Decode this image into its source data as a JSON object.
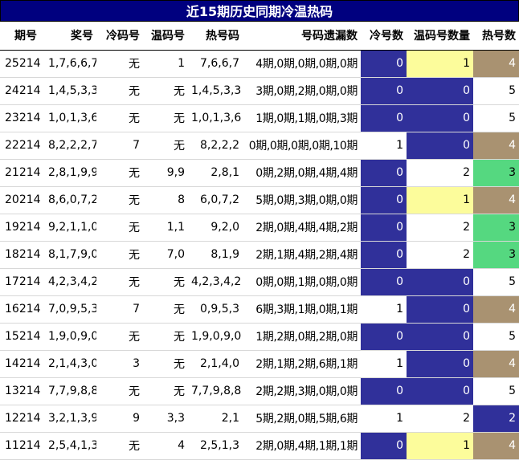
{
  "title": "近15期历史同期冷温热码",
  "headers": [
    "期号",
    "奖号",
    "冷码号",
    "温码号",
    "热号码",
    "号码遗漏数",
    "冷号数",
    "温码号数量",
    "热号数"
  ],
  "colors": {
    "title_bg": "#00007f",
    "navy": "#30309a",
    "yellow": "#fcfc9b",
    "tan": "#a99271",
    "green": "#55d880",
    "white": "#ffffff"
  },
  "rows": [
    {
      "issue": "25214",
      "draw": "1,7,6,6,7",
      "cold": "无",
      "warm": "1",
      "hot": "7,6,6,7",
      "miss": "4期,0期,0期,0期,0期",
      "cold_count": "0",
      "warm_count": "1",
      "hot_count": "4",
      "cold_style": "navy",
      "warm_style": "yellow",
      "hot_style": "tan"
    },
    {
      "issue": "24214",
      "draw": "1,4,5,3,3",
      "cold": "无",
      "warm": "无",
      "hot": "1,4,5,3,3",
      "miss": "3期,0期,2期,0期,0期",
      "cold_count": "0",
      "warm_count": "0",
      "hot_count": "5",
      "cold_style": "navy",
      "warm_style": "navy",
      "hot_style": "plain"
    },
    {
      "issue": "23214",
      "draw": "1,0,1,3,6",
      "cold": "无",
      "warm": "无",
      "hot": "1,0,1,3,6",
      "miss": "1期,0期,1期,0期,3期",
      "cold_count": "0",
      "warm_count": "0",
      "hot_count": "5",
      "cold_style": "navy",
      "warm_style": "navy",
      "hot_style": "plain"
    },
    {
      "issue": "22214",
      "draw": "8,2,2,2,7",
      "cold": "7",
      "warm": "无",
      "hot": "8,2,2,2",
      "miss": "0期,0期,0期,0期,10期",
      "cold_count": "1",
      "warm_count": "0",
      "hot_count": "4",
      "cold_style": "plain",
      "warm_style": "navy",
      "hot_style": "tan"
    },
    {
      "issue": "21214",
      "draw": "2,8,1,9,9",
      "cold": "无",
      "warm": "9,9",
      "hot": "2,8,1",
      "miss": "0期,2期,0期,4期,4期",
      "cold_count": "0",
      "warm_count": "2",
      "hot_count": "3",
      "cold_style": "navy",
      "warm_style": "plain",
      "hot_style": "green"
    },
    {
      "issue": "20214",
      "draw": "8,6,0,7,2",
      "cold": "无",
      "warm": "8",
      "hot": "6,0,7,2",
      "miss": "5期,0期,3期,0期,0期",
      "cold_count": "0",
      "warm_count": "1",
      "hot_count": "4",
      "cold_style": "navy",
      "warm_style": "yellow",
      "hot_style": "tan"
    },
    {
      "issue": "19214",
      "draw": "9,2,1,1,0",
      "cold": "无",
      "warm": "1,1",
      "hot": "9,2,0",
      "miss": "2期,0期,4期,4期,2期",
      "cold_count": "0",
      "warm_count": "2",
      "hot_count": "3",
      "cold_style": "navy",
      "warm_style": "plain",
      "hot_style": "green"
    },
    {
      "issue": "18214",
      "draw": "8,1,7,9,0",
      "cold": "无",
      "warm": "7,0",
      "hot": "8,1,9",
      "miss": "2期,1期,4期,2期,4期",
      "cold_count": "0",
      "warm_count": "2",
      "hot_count": "3",
      "cold_style": "navy",
      "warm_style": "plain",
      "hot_style": "green"
    },
    {
      "issue": "17214",
      "draw": "4,2,3,4,2",
      "cold": "无",
      "warm": "无",
      "hot": "4,2,3,4,2",
      "miss": "0期,0期,1期,0期,0期",
      "cold_count": "0",
      "warm_count": "0",
      "hot_count": "5",
      "cold_style": "navy",
      "warm_style": "navy",
      "hot_style": "plain"
    },
    {
      "issue": "16214",
      "draw": "7,0,9,5,3",
      "cold": "7",
      "warm": "无",
      "hot": "0,9,5,3",
      "miss": "6期,3期,1期,0期,1期",
      "cold_count": "1",
      "warm_count": "0",
      "hot_count": "4",
      "cold_style": "plain",
      "warm_style": "navy",
      "hot_style": "tan"
    },
    {
      "issue": "15214",
      "draw": "1,9,0,9,0",
      "cold": "无",
      "warm": "无",
      "hot": "1,9,0,9,0",
      "miss": "1期,2期,0期,2期,0期",
      "cold_count": "0",
      "warm_count": "0",
      "hot_count": "5",
      "cold_style": "navy",
      "warm_style": "navy",
      "hot_style": "plain"
    },
    {
      "issue": "14214",
      "draw": "2,1,4,3,0",
      "cold": "3",
      "warm": "无",
      "hot": "2,1,4,0",
      "miss": "2期,1期,2期,6期,1期",
      "cold_count": "1",
      "warm_count": "0",
      "hot_count": "4",
      "cold_style": "plain",
      "warm_style": "navy",
      "hot_style": "tan"
    },
    {
      "issue": "13214",
      "draw": "7,7,9,8,8",
      "cold": "无",
      "warm": "无",
      "hot": "7,7,9,8,8",
      "miss": "2期,2期,3期,0期,0期",
      "cold_count": "0",
      "warm_count": "0",
      "hot_count": "5",
      "cold_style": "navy",
      "warm_style": "navy",
      "hot_style": "plain"
    },
    {
      "issue": "12214",
      "draw": "3,2,1,3,9",
      "cold": "9",
      "warm": "3,3",
      "hot": "2,1",
      "miss": "5期,2期,0期,5期,6期",
      "cold_count": "1",
      "warm_count": "2",
      "hot_count": "2",
      "cold_style": "plain",
      "warm_style": "plain",
      "hot_style": "navy"
    },
    {
      "issue": "11214",
      "draw": "2,5,4,1,3",
      "cold": "无",
      "warm": "4",
      "hot": "2,5,1,3",
      "miss": "2期,0期,4期,1期,1期",
      "cold_count": "0",
      "warm_count": "1",
      "hot_count": "4",
      "cold_style": "navy",
      "warm_style": "yellow",
      "hot_style": "tan"
    }
  ]
}
